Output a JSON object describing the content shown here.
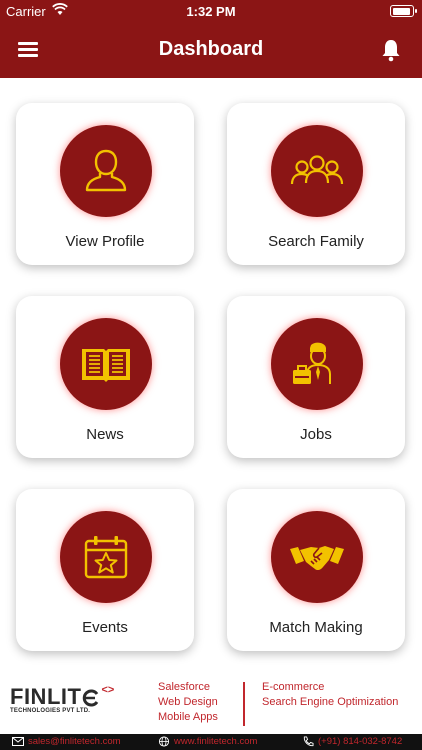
{
  "status": {
    "carrier": "Carrier",
    "time": "1:32 PM"
  },
  "nav": {
    "title": "Dashboard"
  },
  "cards": [
    {
      "label": "View Profile",
      "icon": "user-icon"
    },
    {
      "label": "Search Family",
      "icon": "group-icon"
    },
    {
      "label": "News",
      "icon": "book-icon"
    },
    {
      "label": "Jobs",
      "icon": "businessman-icon"
    },
    {
      "label": "Events",
      "icon": "calendar-star-icon"
    },
    {
      "label": "Match Making",
      "icon": "handshake-icon"
    }
  ],
  "footer": {
    "logo_text": "FINLIT",
    "logo_code": "<>",
    "logo_sub": "TECHNOLOGIES PVT LTD.",
    "services_left": [
      "Salesforce",
      "Web Design",
      "Mobile Apps"
    ],
    "services_right": [
      "E-commerce",
      "Search Engine Optimization"
    ],
    "email": "sales@finlitetech.com",
    "website": "www.finlitetech.com",
    "phone": "(+91) 814-032-8742"
  },
  "colors": {
    "brand": "#8b1515",
    "icon": "#f2c200",
    "accent": "#c1272d"
  }
}
